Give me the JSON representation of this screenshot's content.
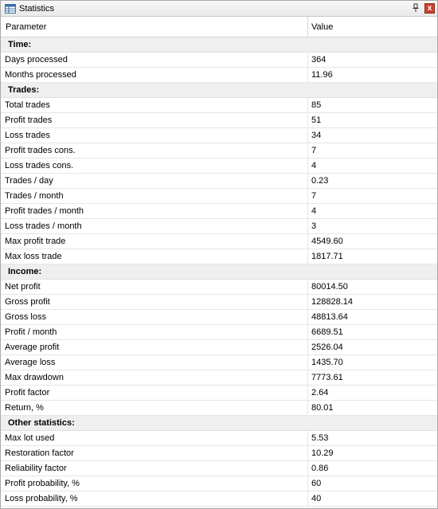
{
  "window": {
    "title": "Statistics",
    "icon": "table-icon",
    "pin_icon": "pin-icon",
    "close_icon": "close-icon",
    "close_label": "x"
  },
  "table": {
    "headers": {
      "parameter": "Parameter",
      "value": "Value"
    },
    "sections": [
      {
        "title": "Time:",
        "rows": [
          {
            "parameter": "Days processed",
            "value": "364"
          },
          {
            "parameter": "Months processed",
            "value": "11.96"
          }
        ]
      },
      {
        "title": "Trades:",
        "rows": [
          {
            "parameter": "Total trades",
            "value": "85"
          },
          {
            "parameter": "Profit trades",
            "value": "51"
          },
          {
            "parameter": "Loss trades",
            "value": "34"
          },
          {
            "parameter": "Profit trades cons.",
            "value": "7"
          },
          {
            "parameter": "Loss trades cons.",
            "value": "4"
          },
          {
            "parameter": "Trades / day",
            "value": "0.23"
          },
          {
            "parameter": "Trades / month",
            "value": "7"
          },
          {
            "parameter": "Profit trades / month",
            "value": "4"
          },
          {
            "parameter": "Loss trades / month",
            "value": "3"
          },
          {
            "parameter": "Max profit trade",
            "value": "4549.60"
          },
          {
            "parameter": "Max loss trade",
            "value": "1817.71"
          }
        ]
      },
      {
        "title": "Income:",
        "rows": [
          {
            "parameter": "Net profit",
            "value": "80014.50"
          },
          {
            "parameter": "Gross profit",
            "value": "128828.14"
          },
          {
            "parameter": "Gross loss",
            "value": "48813.64"
          },
          {
            "parameter": "Profit / month",
            "value": "6689.51"
          },
          {
            "parameter": "Average profit",
            "value": "2526.04"
          },
          {
            "parameter": "Average loss",
            "value": "1435.70"
          },
          {
            "parameter": "Max drawdown",
            "value": "7773.61"
          },
          {
            "parameter": "Profit factor",
            "value": "2.64"
          },
          {
            "parameter": "Return, %",
            "value": "80.01"
          }
        ]
      },
      {
        "title": "Other statistics:",
        "rows": [
          {
            "parameter": "Max lot used",
            "value": "5.53"
          },
          {
            "parameter": "Restoration factor",
            "value": "10.29"
          },
          {
            "parameter": "Reliability factor",
            "value": "0.86"
          },
          {
            "parameter": "Profit probability, %",
            "value": "60"
          },
          {
            "parameter": "Loss probability, %",
            "value": "40"
          }
        ]
      }
    ]
  }
}
